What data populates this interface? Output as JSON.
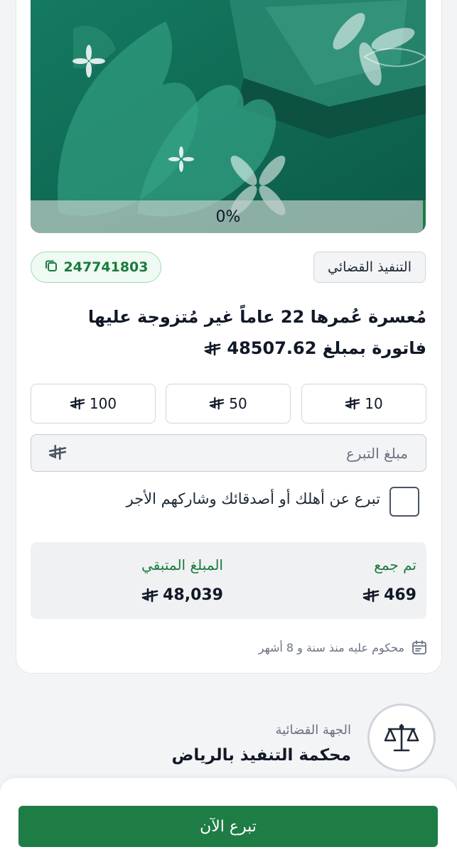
{
  "hero": {
    "progress_text": "0%",
    "progress_value": 0
  },
  "case_number": "247741803",
  "category": "التنفيذ القضائي",
  "title": "مُعسرة عُمرها 22 عاماً غير مُتزوجة عليها فاتورة بمبلغ 48507.62",
  "amount_options": [
    "100",
    "50",
    "10"
  ],
  "donation_input": {
    "placeholder": "مبلغ التبرع",
    "value": ""
  },
  "gift_checkbox": {
    "label": "تبرع عن أهلك أو أصدقائك وشاركهم الأجر",
    "checked": false
  },
  "stats": {
    "collected_label": "تم جمع",
    "collected_value": "469",
    "remaining_label": "المبلغ المتبقي",
    "remaining_value": "48,039"
  },
  "ruling_date": "محكوم عليه منذ سنة و 8 أشهر",
  "authority": {
    "label": "الجهة القضائية",
    "name": "محكمة التنفيذ بالرياض"
  },
  "donate_button": "تبرع الآن",
  "colors": {
    "primary": "#1e7d45",
    "hero": "#0f6a55",
    "accent_text": "#1b7a3f"
  },
  "icons": [
    "copy-icon",
    "calendar-icon",
    "scales-icon",
    "riyal-icon"
  ]
}
